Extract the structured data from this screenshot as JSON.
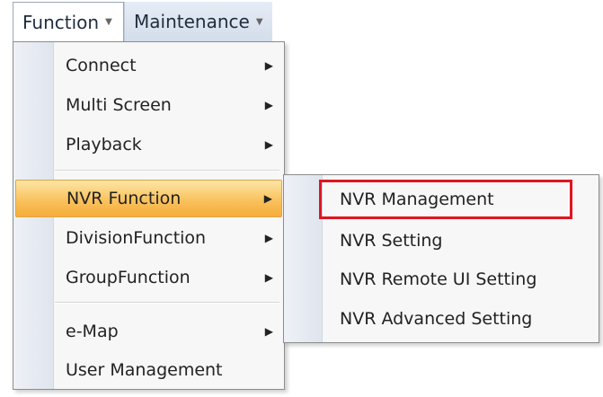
{
  "menubar": {
    "items": [
      {
        "label": "Function"
      },
      {
        "label": "Maintenance"
      }
    ]
  },
  "dropdown": {
    "items": [
      {
        "label": "Connect",
        "has_submenu": true
      },
      {
        "label": "Multi Screen",
        "has_submenu": true
      },
      {
        "label": "Playback",
        "has_submenu": true
      },
      {
        "label": "NVR Function",
        "has_submenu": true,
        "highlighted": true
      },
      {
        "label": "DivisionFunction",
        "has_submenu": true
      },
      {
        "label": "GroupFunction",
        "has_submenu": true
      },
      {
        "label": "e-Map",
        "has_submenu": true
      },
      {
        "label": "User Management",
        "has_submenu": false
      }
    ]
  },
  "submenu": {
    "items": [
      {
        "label": "NVR Management",
        "outlined": true
      },
      {
        "label": "NVR Setting"
      },
      {
        "label": "NVR Remote UI Setting"
      },
      {
        "label": "NVR Advanced Setting"
      }
    ]
  },
  "colors": {
    "highlight": "#f9c25e",
    "outline": "#e0151f",
    "menubar": "#dde6f2"
  },
  "icons": {
    "dropdown_arrow": "chevron-down-icon",
    "submenu_arrow": "chevron-right-icon"
  }
}
